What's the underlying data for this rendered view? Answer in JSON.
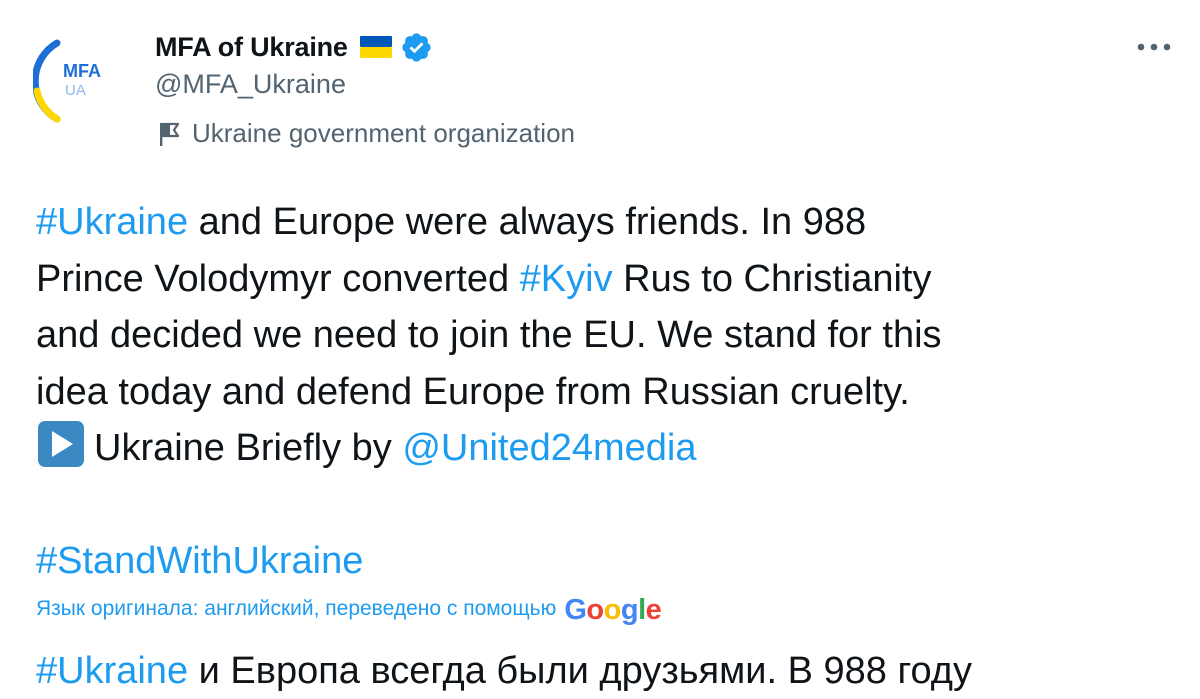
{
  "author": {
    "display_name": "MFA of Ukraine",
    "handle": "@MFA_Ukraine",
    "label": "Ukraine government organization",
    "avatar_text_top": "MFA",
    "avatar_text_bottom": "UA"
  },
  "tweet": {
    "line1_tag": "#Ukraine",
    "line1_rest": " and Europe were always friends. In 988",
    "line2_pre": "Prince Volodymyr converted ",
    "line2_tag": "#Kyiv",
    "line2_post": " Rus to Christianity",
    "line3": "and decided we need to join the EU. We stand for this",
    "line4": "idea today and defend Europe from Russian cruelty.",
    "line5_text": "Ukraine Briefly by ",
    "line5_mention": "@United24media",
    "hashtag_final": "#StandWithUkraine"
  },
  "translation": {
    "label": "Язык оригинала: английский, переведено с помощью",
    "provider": "Google",
    "text_tag": "#Ukraine",
    "text_rest": " и Европа всегда были друзьями. В 988 году"
  },
  "colors": {
    "accent": "#1d9bf0",
    "secondary_text": "#536471",
    "primary_text": "#0f1419",
    "flag_blue": "#0057b7",
    "flag_yellow": "#ffd700"
  },
  "icons": {
    "more": "more-icon",
    "verified": "verified-icon",
    "org_flag": "flag-icon",
    "play": "play-icon"
  }
}
